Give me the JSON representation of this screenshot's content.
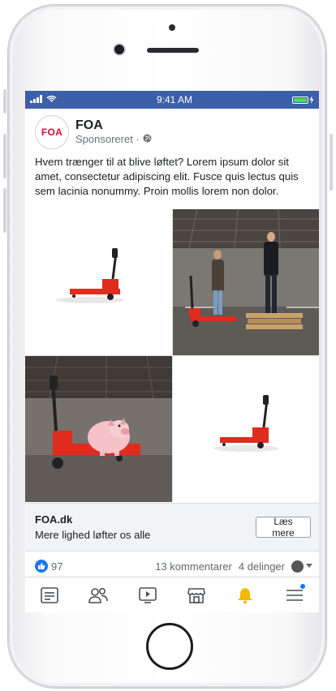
{
  "status_bar": {
    "time": "9:41 AM"
  },
  "post": {
    "page_name": "FOA",
    "logo_text": "FOA",
    "sponsored_label": "Sponsoreret · ",
    "body_text": "Hvem trænger til at blive løftet? Lorem ipsum dolor sit amet, consectetur adipiscing elit. Fusce quis lectus quis sem lacinia nonummy. Proin mollis lorem non dolor."
  },
  "link_preview": {
    "domain": "FOA.dk",
    "headline": "Mere lighed løfter os alle",
    "cta_label": "Læs mere"
  },
  "reactions": {
    "like_count": "97",
    "comments": "13 kommentarer",
    "shares": "4 delinger"
  },
  "nav": {
    "items": [
      "news-feed",
      "friends",
      "watch",
      "marketplace",
      "notifications",
      "menu"
    ]
  },
  "colors": {
    "status_bar": "#3b5fa8",
    "accent": "#1877f2",
    "pallet_truck": "#e02b1f",
    "brand": "#d0122f",
    "bell": "#f5b800"
  }
}
